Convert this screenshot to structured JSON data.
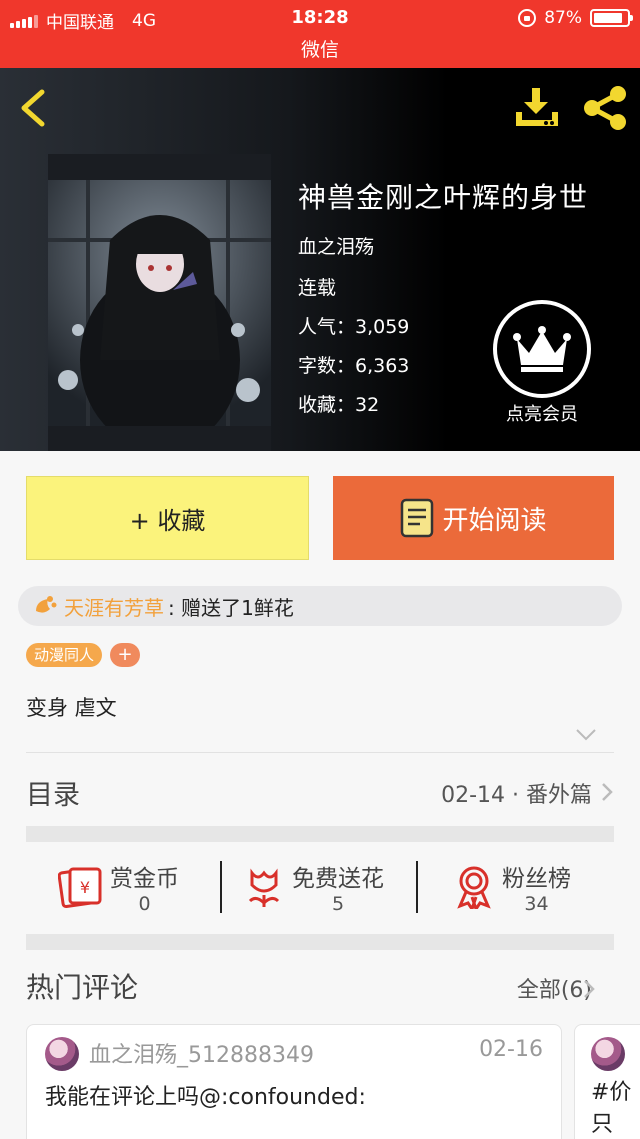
{
  "status_bar": {
    "carrier": "中国联通",
    "network": "4G",
    "time": "18:28",
    "battery": "87%",
    "battery_level": 0.87
  },
  "app_title": "微信",
  "book": {
    "title": "神兽金刚之叶辉的身世",
    "author": "血之泪殇",
    "status": "连载",
    "popularity": "人气：3,059",
    "word_count": "字数：6,363",
    "favorites": "收藏：32"
  },
  "vip": {
    "label": "点亮会员"
  },
  "buttons": {
    "favorite": "+ 收藏",
    "read": "开始阅读"
  },
  "gift_banner": {
    "giver": "天涯有芳草",
    "message": ": 赠送了1鲜花"
  },
  "tags": [
    "动漫同人"
  ],
  "tag_add": "+",
  "description": "变身 虐文",
  "toc": {
    "label": "目录",
    "latest": "02-14 · 番外篇"
  },
  "actions": [
    {
      "label": "赏金币",
      "count": "0"
    },
    {
      "label": "免费送花",
      "count": "5"
    },
    {
      "label": "粉丝榜",
      "count": "34"
    }
  ],
  "comments": {
    "title": "热门评论",
    "all_label": "全部(6)",
    "items": [
      {
        "user": "血之泪殇_512888349",
        "date": "02-16",
        "text": "我能在评论上吗@:confounded:"
      },
      {
        "text": "#价\n只"
      }
    ]
  },
  "colors": {
    "header_red": "#f0372c",
    "accent_yellow": "#f2d72f",
    "read_orange": "#eb6a3a",
    "favorite_yellow": "#fbf37c"
  },
  "icons": [
    "back-icon",
    "download-icon",
    "share-icon",
    "crown-icon",
    "book-icon",
    "flower-icon",
    "coin-icon",
    "medal-icon",
    "chevron-right-icon",
    "chevron-down-icon"
  ]
}
